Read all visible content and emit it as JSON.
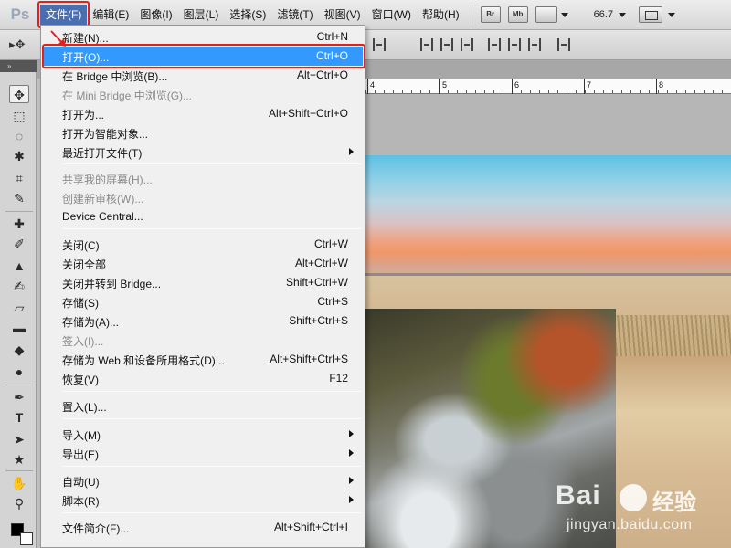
{
  "app": {
    "logo": "Ps"
  },
  "menubar": {
    "items": [
      {
        "label": "文件(F)"
      },
      {
        "label": "编辑(E)"
      },
      {
        "label": "图像(I)"
      },
      {
        "label": "图层(L)"
      },
      {
        "label": "选择(S)"
      },
      {
        "label": "滤镜(T)"
      },
      {
        "label": "视图(V)"
      },
      {
        "label": "窗口(W)"
      },
      {
        "label": "帮助(H)"
      }
    ],
    "bridge_button": "Br",
    "minibridge_button": "Mb",
    "zoom": "66.7"
  },
  "ruler": {
    "numbers": [
      "4",
      "5",
      "6",
      "7",
      "8"
    ]
  },
  "file_menu": {
    "items": [
      {
        "label": "新建(N)...",
        "shortcut": "Ctrl+N"
      },
      {
        "label": "打开(O)...",
        "shortcut": "Ctrl+O",
        "state": "highlighted"
      },
      {
        "label": "在 Bridge 中浏览(B)...",
        "shortcut": "Alt+Ctrl+O"
      },
      {
        "label": "在 Mini Bridge 中浏览(G)...",
        "shortcut": "",
        "state": "disabled"
      },
      {
        "label": "打开为...",
        "shortcut": "Alt+Shift+Ctrl+O"
      },
      {
        "label": "打开为智能对象...",
        "shortcut": ""
      },
      {
        "label": "最近打开文件(T)",
        "shortcut": "",
        "submenu": true
      },
      {
        "label": "共享我的屏幕(H)...",
        "shortcut": "",
        "state": "disabled"
      },
      {
        "label": "创建新审核(W)...",
        "shortcut": "",
        "state": "disabled"
      },
      {
        "label": "Device Central...",
        "shortcut": ""
      },
      {
        "label": "关闭(C)",
        "shortcut": "Ctrl+W"
      },
      {
        "label": "关闭全部",
        "shortcut": "Alt+Ctrl+W"
      },
      {
        "label": "关闭并转到 Bridge...",
        "shortcut": "Shift+Ctrl+W"
      },
      {
        "label": "存储(S)",
        "shortcut": "Ctrl+S"
      },
      {
        "label": "存储为(A)...",
        "shortcut": "Shift+Ctrl+S"
      },
      {
        "label": "签入(I)...",
        "shortcut": "",
        "state": "disabled"
      },
      {
        "label": "存储为 Web 和设备所用格式(D)...",
        "shortcut": "Alt+Shift+Ctrl+S"
      },
      {
        "label": "恢复(V)",
        "shortcut": "F12"
      },
      {
        "label": "置入(L)...",
        "shortcut": ""
      },
      {
        "label": "导入(M)",
        "shortcut": "",
        "submenu": true
      },
      {
        "label": "导出(E)",
        "shortcut": "",
        "submenu": true
      },
      {
        "label": "自动(U)",
        "shortcut": "",
        "submenu": true
      },
      {
        "label": "脚本(R)",
        "shortcut": "",
        "submenu": true
      },
      {
        "label": "文件简介(F)...",
        "shortcut": "Alt+Shift+Ctrl+I"
      }
    ]
  },
  "watermark": {
    "brand": "Bai",
    "sub": "经验",
    "url": "jingyan.baidu.com"
  },
  "colors": {
    "highlight": "#3399ff",
    "annotation": "#e0211e",
    "menu_bg": "#f0f0f0"
  }
}
